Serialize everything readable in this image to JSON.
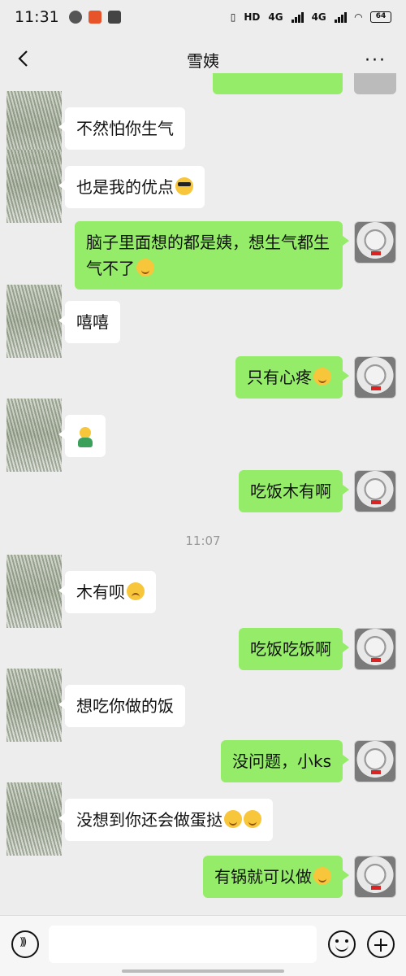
{
  "status_bar": {
    "time": "11:31",
    "network1": "4G",
    "network2": "4G",
    "battery": "64",
    "hd_label": "HD"
  },
  "nav": {
    "title": "雪姨",
    "more": "···"
  },
  "messages": [
    {
      "from": "friend",
      "text": "不然怕你生气",
      "emoji": null
    },
    {
      "from": "friend",
      "text": "也是我的优点",
      "emoji": "cool-emoji"
    },
    {
      "from": "self",
      "text": "脑子里面想的都是姨，想生气都生气不了",
      "emoji": "smile-emoji"
    },
    {
      "from": "friend",
      "text": "嘻嘻",
      "emoji": null
    },
    {
      "from": "self",
      "text": "只有心疼",
      "emoji": "crying-laughing-emoji"
    },
    {
      "from": "friend",
      "text": "",
      "emoji": "figure-sticker"
    },
    {
      "from": "self",
      "text": "吃饭木有啊",
      "emoji": null
    },
    {
      "from": "friend",
      "text": "木有呗",
      "emoji": "frown-emoji"
    },
    {
      "from": "self",
      "text": "吃饭吃饭啊",
      "emoji": null
    },
    {
      "from": "friend",
      "text": "想吃你做的饭",
      "emoji": null
    },
    {
      "from": "self",
      "text": "没问题，小ks",
      "emoji": null
    },
    {
      "from": "friend",
      "text": "没想到你还会做蛋挞",
      "emoji": "smile-emoji"
    },
    {
      "from": "self",
      "text": "有锅就可以做",
      "emoji": "thinking-emoji"
    }
  ],
  "timestamp": "11:07",
  "input": {
    "placeholder": ""
  }
}
